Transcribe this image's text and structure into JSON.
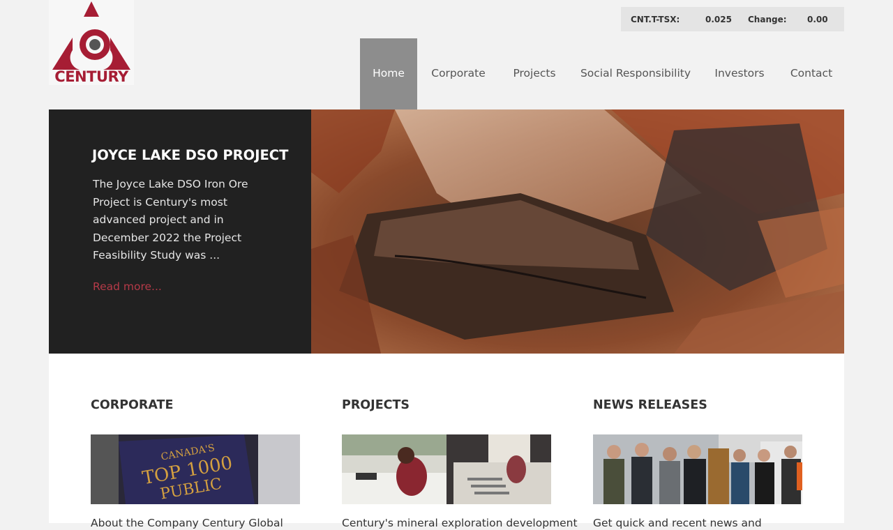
{
  "brand": {
    "logo_word": "CENTURY",
    "color": "#a61d34"
  },
  "ticker": {
    "symbol_label": "CNT.T-TSX:",
    "price": "0.025",
    "change_label": "Change:",
    "change_value": "0.00"
  },
  "nav": {
    "items": [
      {
        "label": "Home",
        "active": true
      },
      {
        "label": "Corporate"
      },
      {
        "label": "Projects"
      },
      {
        "label": "Social Responsibility"
      },
      {
        "label": "Investors"
      },
      {
        "label": "Contact"
      }
    ],
    "active_color": "#8d8d8d"
  },
  "hero": {
    "title": "JOYCE LAKE DSO PROJECT",
    "text": "The Joyce Lake DSO Iron Ore Project is Century's most advanced project and in December 2022 the Project Feasibility Study was ...",
    "link": "Read more...",
    "link_color": "#b53a48",
    "image": "iron-ore-rocks-photo"
  },
  "sections": [
    {
      "heading": "CORPORATE",
      "image": "top-1000-public-companies-photo",
      "caption": "About the Company Century Global"
    },
    {
      "heading": "PROJECTS",
      "image": "core-logging-photo",
      "caption": "Century's mineral exploration development"
    },
    {
      "heading": "NEWS RELEASES",
      "image": "site-visit-group-photo",
      "caption": "Get quick and recent news and"
    }
  ]
}
